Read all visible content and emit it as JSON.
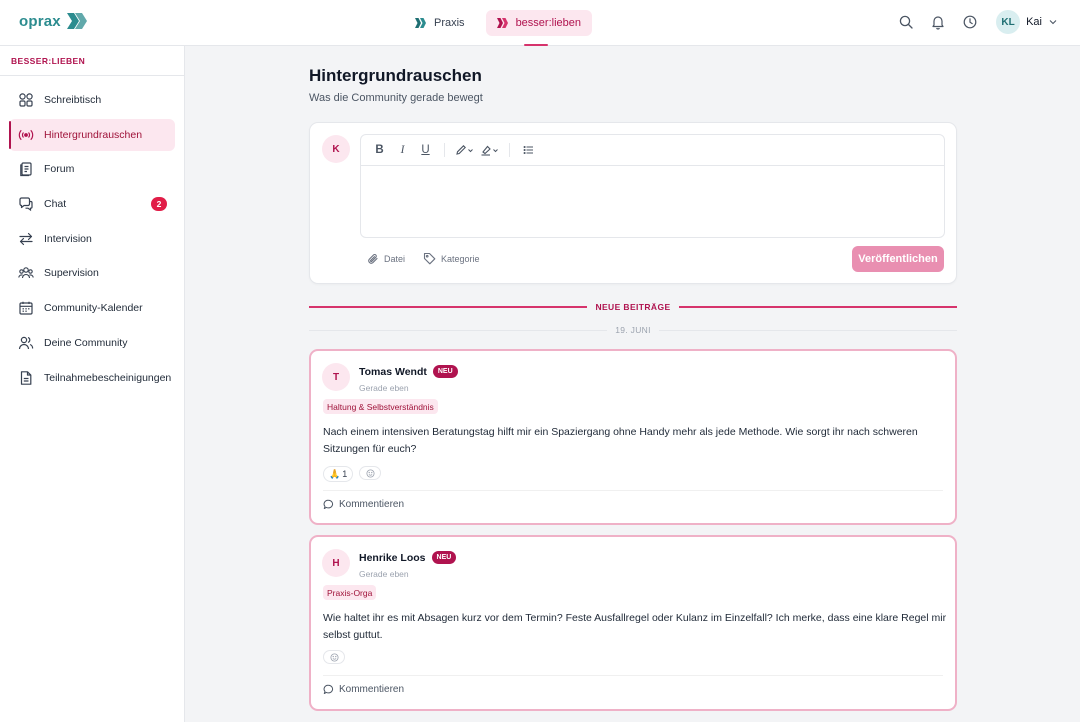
{
  "app": {
    "logo_text": "oprax"
  },
  "top_nav": {
    "tabs": [
      {
        "label": "Praxis",
        "active": false
      },
      {
        "label": "besser:lieben",
        "active": true
      }
    ],
    "user": {
      "initials": "KL",
      "name": "Kai"
    }
  },
  "sidebar": {
    "section_title": "BESSER:LIEBEN",
    "items": [
      {
        "label": "Schreibtisch",
        "icon": "grid-icon"
      },
      {
        "label": "Hintergrundrauschen",
        "icon": "broadcast-icon",
        "active": true
      },
      {
        "label": "Forum",
        "icon": "forum-icon"
      },
      {
        "label": "Chat",
        "icon": "chat-icon",
        "badge": "2"
      },
      {
        "label": "Intervision",
        "icon": "swap-icon"
      },
      {
        "label": "Supervision",
        "icon": "group-icon"
      },
      {
        "label": "Community-Kalender",
        "icon": "calendar-icon"
      },
      {
        "label": "Deine Community",
        "icon": "users-icon"
      },
      {
        "label": "Teilnahmebescheinigungen",
        "icon": "document-icon"
      }
    ]
  },
  "main": {
    "title": "Hintergrundrauschen",
    "subtitle": "Was die Community gerade bewegt",
    "composer": {
      "avatar_initial": "K",
      "toolbar": {
        "bold": "B",
        "italic": "I",
        "underline": "U"
      },
      "file_label": "Datei",
      "category_label": "Kategorie",
      "publish_label": "Veröffentlichen"
    },
    "new_posts_label": "NEUE BEITRÄGE",
    "date_label": "19. JUNI",
    "posts": [
      {
        "initial": "T",
        "author": "Tomas Wendt",
        "badge": "NEU",
        "time": "Gerade eben",
        "tag": "Haltung & Selbstverständnis",
        "text": "Nach einem intensiven Beratungstag hilft mir ein Spaziergang ohne Handy mehr als jede Methode. Wie sorgt ihr nach schweren Sitzungen für euch?",
        "reaction_emoji": "🙏",
        "reaction_count": "1",
        "comment_label": "Kommentieren"
      },
      {
        "initial": "H",
        "author": "Henrike Loos",
        "badge": "NEU",
        "time": "Gerade eben",
        "tag": "Praxis-Orga",
        "text": "Wie haltet ihr es mit Absagen kurz vor dem Termin? Feste Ausfallregel oder Kulanz im Einzelfall? Ich merke, dass eine klare Regel mir selbst guttut.",
        "comment_label": "Kommentieren"
      }
    ]
  },
  "colors": {
    "brand_teal": "#2c8c8f",
    "accent": "#b0134f",
    "accent_light": "#fce7ef",
    "badge_red": "#e11d48"
  }
}
